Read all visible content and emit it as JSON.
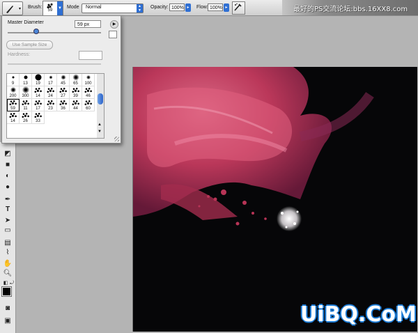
{
  "options_bar": {
    "brush_label": "Brush:",
    "brush_size": "59",
    "mode_label": "Mode",
    "mode_value": "Normal",
    "opacity_label": "Opacity:",
    "opacity_value": "100%",
    "flow_label": "Flow:",
    "flow_value": "100%",
    "watermark": "最好的PS交流论坛:bbs.16XX8.com"
  },
  "brush_panel": {
    "master_diameter_label": "Master Diameter",
    "master_diameter_value": "59 px",
    "use_sample_size_label": "Use Sample Size",
    "hardness_label": "Hardness:",
    "brush_sizes": [
      "9",
      "13",
      "19",
      "17",
      "45",
      "65",
      "100",
      "200",
      "300",
      "14",
      "24",
      "27",
      "39",
      "46",
      "59",
      "11",
      "17",
      "23",
      "36",
      "44",
      "60",
      "14",
      "26",
      "33"
    ],
    "selected_brush": "59"
  },
  "canvas": {
    "watermark": "UiBQ.CoM"
  },
  "colors": {
    "accent": "#2f6fd3",
    "canvas_bg": "#060608",
    "paint": "#d94a6e"
  }
}
